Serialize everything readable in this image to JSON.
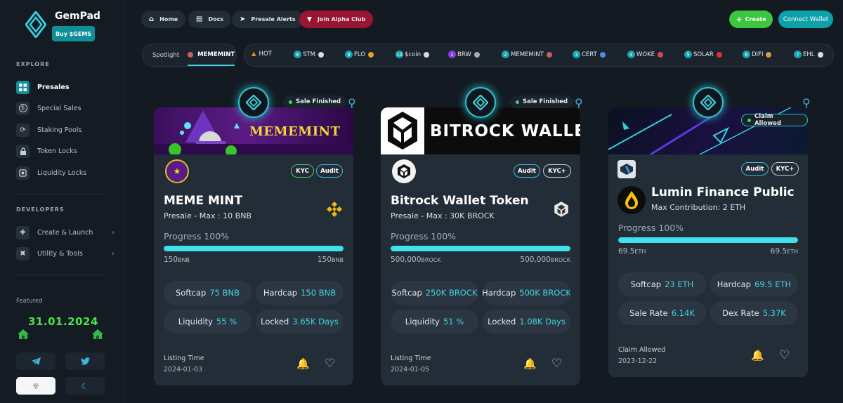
{
  "brand": {
    "name": "GemPad",
    "buy_label": "Buy $GEMS"
  },
  "sidebar": {
    "explore_title": "EXPLORE",
    "explore_items": [
      {
        "label": "Presales",
        "icon": "grid-icon",
        "active": true
      },
      {
        "label": "Special Sales",
        "icon": "dollar-icon"
      },
      {
        "label": "Staking Pools",
        "icon": "staking-icon"
      },
      {
        "label": "Token Locks",
        "icon": "lock-icon"
      },
      {
        "label": "Liquidity Locks",
        "icon": "liquidity-lock-icon"
      }
    ],
    "developers_title": "DEVELOPERS",
    "developer_items": [
      {
        "label": "Create & Launch",
        "icon": "gamepad-icon"
      },
      {
        "label": "Utility & Tools",
        "icon": "tools-icon"
      }
    ],
    "featured_title": "Featured",
    "featured_date": "31.01.2024"
  },
  "topbar": {
    "home": "Home",
    "docs": "Docs",
    "presale_alerts": "Presale Alerts",
    "alpha_club": "Join Alpha Club",
    "create": "Create",
    "connect_wallet": "Connect Wallet"
  },
  "spotlight": {
    "label": "Spotlight",
    "name": "MEMEMINT"
  },
  "ticker": [
    {
      "num": "",
      "name": "HOT",
      "color": "#f08a1c"
    },
    {
      "num": "8",
      "name": "STM",
      "color": "#dddddd"
    },
    {
      "num": "9",
      "name": "FLO",
      "color": "#e0a020"
    },
    {
      "num": "10",
      "name": "$coin",
      "color": "#d8d8d8"
    },
    {
      "num": "1",
      "name": "BRW",
      "color": "#aaaaaa"
    },
    {
      "num": "2",
      "name": "MEMEMINT",
      "color": "#c86060"
    },
    {
      "num": "3",
      "name": "CERT",
      "color": "#4a90e2"
    },
    {
      "num": "4",
      "name": "WOKE",
      "color": "#e04060"
    },
    {
      "num": "5",
      "name": "SOLAR",
      "color": "#e03030"
    },
    {
      "num": "6",
      "name": "DIFI",
      "color": "#d0a040"
    },
    {
      "num": "7",
      "name": "EHL",
      "color": "#dddddd"
    }
  ],
  "cards": [
    {
      "status": "Sale Finished",
      "banner_text": "MEMEMINT",
      "tags": [
        "KYC",
        "Audit"
      ],
      "title": "MEME MINT",
      "subtitle": "Presale - Max : 10 BNB",
      "progress_label": "Progress 100%",
      "progress": 1.0,
      "amount_left": "150",
      "amount_right": "150",
      "unit": "BNB",
      "stats": [
        {
          "label": "Softcap",
          "value": "75 BNB"
        },
        {
          "label": "Hardcap",
          "value": "150 BNB"
        },
        {
          "label": "Liquidity",
          "value": "55 %"
        },
        {
          "label": "Locked",
          "value": "3.65K Days"
        }
      ],
      "footer_label": "Listing Time",
      "footer_value": "2024-01-03"
    },
    {
      "status": "Sale Finished",
      "banner_text": "BITROCK WALLET",
      "tags": [
        "Audit",
        "KYC+"
      ],
      "title": "Bitrock Wallet Token",
      "subtitle": "Presale - Max : 30K BROCK",
      "progress_label": "Progress 100%",
      "progress": 1.0,
      "amount_left": "500,000",
      "amount_right": "500,000",
      "unit": "BROCK",
      "stats": [
        {
          "label": "Softcap",
          "value": "250K BROCK"
        },
        {
          "label": "Hardcap",
          "value": "500K BROCK"
        },
        {
          "label": "Liquidity",
          "value": "51 %"
        },
        {
          "label": "Locked",
          "value": "1.08K Days"
        }
      ],
      "footer_label": "Listing Time",
      "footer_value": "2024-01-05"
    },
    {
      "status": "Claim Allowed",
      "banner_text": "",
      "tags": [
        "Audit",
        "KYC+"
      ],
      "title": "Lumin Finance Public Sale",
      "subtitle": "Max Contribution: 2 ETH",
      "progress_label": "Progress 100%",
      "progress": 1.0,
      "amount_left": "69.5",
      "amount_right": "69.5",
      "unit": "ETH",
      "stats": [
        {
          "label": "Softcap",
          "value": "23 ETH"
        },
        {
          "label": "Hardcap",
          "value": "69.5 ETH"
        },
        {
          "label": "Sale Rate",
          "value": "6.14K"
        },
        {
          "label": "Dex Rate",
          "value": "5.37K"
        }
      ],
      "footer_label": "Claim Allowed",
      "footer_value": "2023-12-22"
    }
  ],
  "colors": {
    "accent": "#3fe1ea",
    "brand_teal": "#0f8f9a",
    "create_green": "#3fc63f",
    "alpha_red": "#9a1532",
    "featured_green": "#4ae34a"
  }
}
